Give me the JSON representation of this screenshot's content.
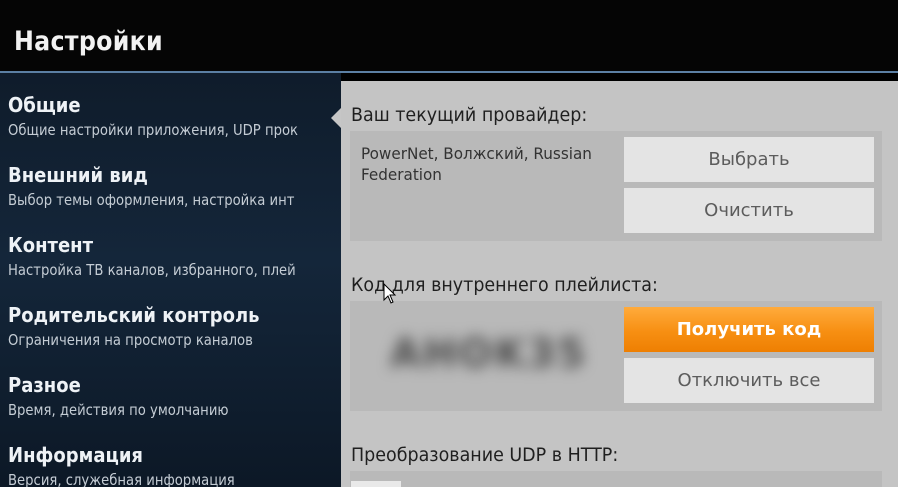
{
  "header": {
    "title": "Настройки"
  },
  "sidebar": {
    "items": [
      {
        "name": "Общие",
        "desc": "Общие настройки приложения, UDP прок"
      },
      {
        "name": "Внешний вид",
        "desc": "Выбор темы оформления, настройка инт"
      },
      {
        "name": "Контент",
        "desc": "Настройка ТВ каналов, избранного, плей"
      },
      {
        "name": "Родительский контроль",
        "desc": "Ограничения на просмотр каналов"
      },
      {
        "name": "Разное",
        "desc": "Время, действия по умолчанию"
      },
      {
        "name": "Информация",
        "desc": "Версия, служебная информация"
      }
    ]
  },
  "main": {
    "provider": {
      "title": "Ваш текущий провайдер:",
      "value": "PowerNet, Волжский, Russian Federation",
      "select_label": "Выбрать",
      "clear_label": "Очистить"
    },
    "playlist": {
      "title": "Код для внутреннего плейлиста:",
      "code": "AHOK35",
      "get_code_label": "Получить код",
      "disable_all_label": "Отключить все"
    },
    "udp": {
      "title": "Преобразование UDP в HTTP:"
    }
  },
  "colors": {
    "accent": "#f78f12",
    "header_line": "#5b7fa3",
    "panel": "#c4c4c4",
    "sidebar": "#13253a"
  }
}
